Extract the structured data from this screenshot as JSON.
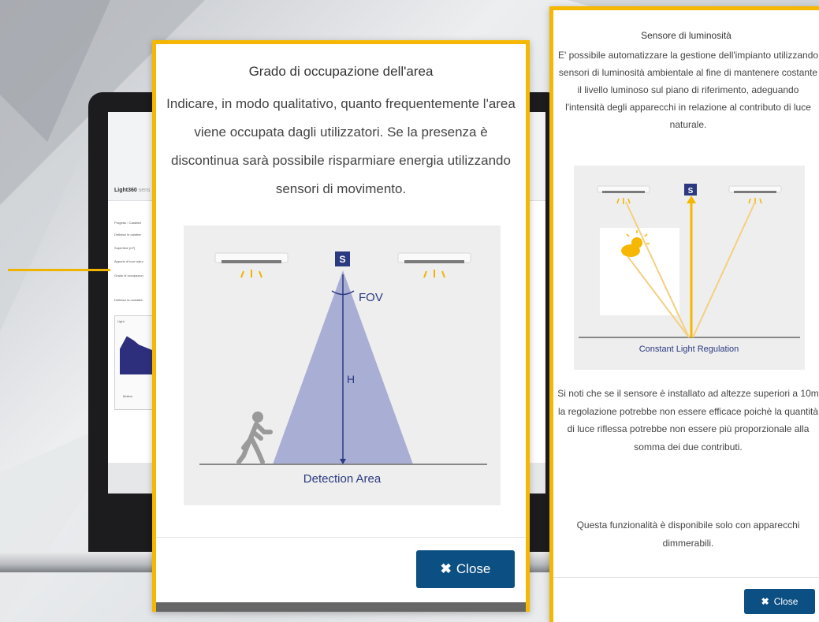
{
  "colors": {
    "accent_border": "#f5b700",
    "button": "#0c4f83",
    "diagram_blue": "#2b3a80"
  },
  "background_app": {
    "logo": "Light360",
    "logo_suffix": "sens",
    "form_lines": [
      "Progetto › Caratteri",
      "Definisci le caratter",
      "Superficie (m²)",
      "Apporto di luce natur",
      "Grado di occupazion",
      "Definisci la modalità"
    ],
    "chart_label": "Light",
    "chart_axis_label": "Motion"
  },
  "modal_occupancy": {
    "title": "Grado di occupazione dell'area",
    "description": "Indicare, in modo qualitativo, quanto frequentemente l'area viene occupata dagli utilizzatori. Se la presenza è discontinua sarà possibile risparmiare energia utilizzando sensori di movimento.",
    "figure": {
      "sensor_letter": "S",
      "fov_label": "FOV",
      "height_label": "H",
      "caption": "Detection Area"
    },
    "close_icon": "close-x-icon",
    "close_label": "Close"
  },
  "modal_light_sensor": {
    "title": "Sensore di luminosità",
    "description": "E' possibile automatizzare la gestione dell'impianto utilizzando sensori di luminosità ambientale al fine di mantenere costante il livello luminoso sul piano di riferimento, adeguando l'intensità degli apparecchi in relazione al contributo di luce naturale.",
    "figure": {
      "sensor_letter": "S",
      "caption": "Constant Light Regulation"
    },
    "note": "Si noti che se il sensore è installato ad altezze superiori a 10m la regolazione potrebbe non essere efficace poichè la quantità di luce riflessa potrebbe non essere più proporzionale alla somma dei due contributi.",
    "availability": "Questa funzionalità è disponibile solo con apparecchi dimmerabili.",
    "close_icon": "close-x-icon",
    "close_label": "Close"
  }
}
